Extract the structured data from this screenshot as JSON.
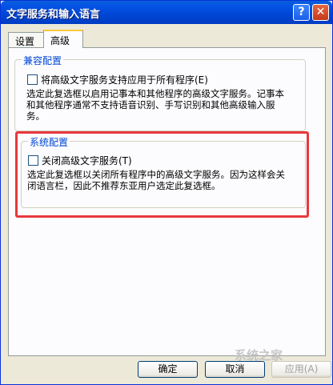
{
  "window": {
    "title": "文字服务和输入语言"
  },
  "titlebar_buttons": {
    "help": "?",
    "close": "✕"
  },
  "tabs": [
    {
      "label": "设置"
    },
    {
      "label": "高级"
    }
  ],
  "compat_group": {
    "title": "兼容配置",
    "checkbox_label": "将高级文字服务支持应用于所有程序(E)",
    "checked": false,
    "description_lines": [
      "选定此复选框以启用记事本和其他程序的高级文字服务。记事本",
      "和其他程序通常不支持语音识别、手写识别和其他高级输入服",
      "务。"
    ]
  },
  "system_group": {
    "title": "系统配置",
    "checkbox_label": "关闭高级文字服务(T)",
    "checked": false,
    "description_lines": [
      "选定此复选框以关闭所有程序中的高级文字服务。因为这样会关",
      "闭语言栏，因此不推荐东亚用户选定此复选框。"
    ]
  },
  "buttons": {
    "ok": "确定",
    "cancel": "取消",
    "apply": "应用(A)"
  },
  "watermark": "系统之家"
}
